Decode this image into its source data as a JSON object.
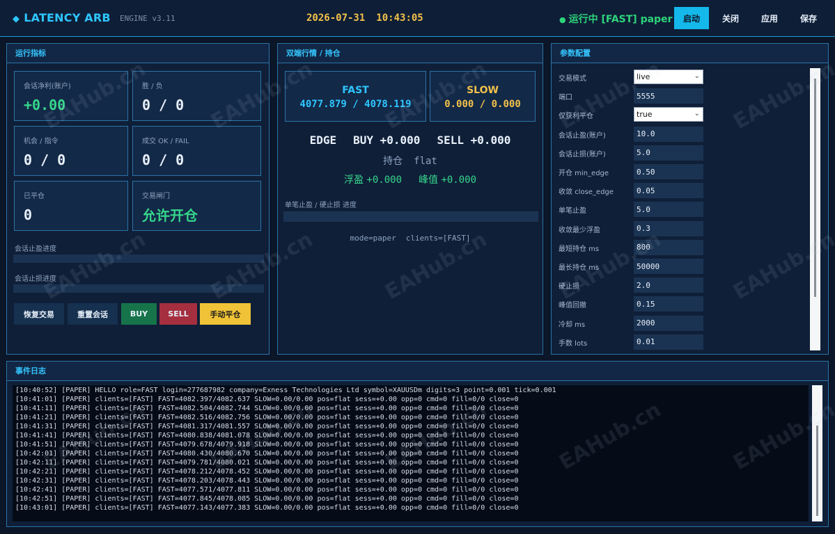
{
  "header": {
    "brand": "LATENCY ARB",
    "engine": "ENGINE v3.11",
    "date": "2026-07-31",
    "time": "10:43:05",
    "status": "运行中 [FAST] paper",
    "buttons": {
      "start": "启动",
      "close": "关闭",
      "apply": "应用",
      "save": "保存"
    }
  },
  "metrics": {
    "title": "运行指标",
    "cards": {
      "net_profit": {
        "label": "会话净利(账户)",
        "value": "+0.00"
      },
      "win_loss": {
        "label": "胜 / 负",
        "value": "0 / 0"
      },
      "opp_cmd": {
        "label": "机会 / 指令",
        "value": "0 / 0"
      },
      "fills": {
        "label": "成交 OK / FAIL",
        "value": "0 / 0"
      },
      "closed": {
        "label": "已平仓",
        "value": "0"
      },
      "gate": {
        "label": "交易闸门",
        "value": "允许开仓"
      }
    },
    "tp_progress": {
      "label": "会话止盈进度",
      "fraction": 0
    },
    "sl_progress": {
      "label": "会话止损进度",
      "fraction": 0
    },
    "actions": {
      "resume": "恢复交易",
      "reset": "重置会话",
      "buy": "BUY",
      "sell": "SELL",
      "manual_close": "手动平仓"
    }
  },
  "market": {
    "title": "双端行情 / 持仓",
    "fast": {
      "name": "FAST",
      "quote": "4077.879 / 4078.119"
    },
    "slow": {
      "name": "SLOW",
      "quote": "0.000 / 0.000"
    },
    "edge": {
      "label": "EDGE",
      "buy": "BUY +0.000",
      "sell": "SELL +0.000"
    },
    "position": {
      "label": "持仓",
      "value": "flat"
    },
    "floating": {
      "label": "浮盈",
      "value": "+0.000"
    },
    "peak": {
      "label": "峰值",
      "value": "+0.000"
    },
    "trade_progress": {
      "label": "单笔止盈 / 硬止损 进度",
      "fraction": 0
    },
    "mode": "mode=paper",
    "clients": "clients=[FAST]"
  },
  "params": {
    "title": "参数配置",
    "rows": [
      {
        "label": "交易模式",
        "value": "live",
        "type": "select"
      },
      {
        "label": "端口",
        "value": "5555",
        "type": "input"
      },
      {
        "label": "仅获利平仓",
        "value": "true",
        "type": "select"
      },
      {
        "label": "会话止盈(账户)",
        "value": "10.0",
        "type": "input"
      },
      {
        "label": "会话止损(账户)",
        "value": "5.0",
        "type": "input"
      },
      {
        "label": "开仓 min_edge",
        "value": "0.50",
        "type": "input"
      },
      {
        "label": "收敛 close_edge",
        "value": "0.05",
        "type": "input"
      },
      {
        "label": "单笔止盈",
        "value": "5.0",
        "type": "input"
      },
      {
        "label": "收敛最少浮盈",
        "value": "0.3",
        "type": "input"
      },
      {
        "label": "最短持仓 ms",
        "value": "800",
        "type": "input"
      },
      {
        "label": "最长持仓 ms",
        "value": "50000",
        "type": "input"
      },
      {
        "label": "硬止损",
        "value": "2.0",
        "type": "input"
      },
      {
        "label": "峰值回撤",
        "value": "0.15",
        "type": "input"
      },
      {
        "label": "冷却 ms",
        "value": "2000",
        "type": "input"
      },
      {
        "label": "手数 lots",
        "value": "0.01",
        "type": "input"
      }
    ]
  },
  "log": {
    "title": "事件日志",
    "lines": [
      "[10:40:52] [PAPER] HELLO role=FAST login=277687982 company=Exness Technologies Ltd symbol=XAUUSDm digits=3 point=0.001 tick=0.001",
      "[10:41:01] [PAPER] clients=[FAST] FAST=4082.397/4082.637 SLOW=0.00/0.00 pos=flat sess=+0.00 opp=0 cmd=0 fill=0/0 close=0",
      "[10:41:11] [PAPER] clients=[FAST] FAST=4082.504/4082.744 SLOW=0.00/0.00 pos=flat sess=+0.00 opp=0 cmd=0 fill=0/0 close=0",
      "[10:41:21] [PAPER] clients=[FAST] FAST=4082.516/4082.756 SLOW=0.00/0.00 pos=flat sess=+0.00 opp=0 cmd=0 fill=0/0 close=0",
      "[10:41:31] [PAPER] clients=[FAST] FAST=4081.317/4081.557 SLOW=0.00/0.00 pos=flat sess=+0.00 opp=0 cmd=0 fill=0/0 close=0",
      "[10:41:41] [PAPER] clients=[FAST] FAST=4080.838/4081.078 SLOW=0.00/0.00 pos=flat sess=+0.00 opp=0 cmd=0 fill=0/0 close=0",
      "[10:41:51] [PAPER] clients=[FAST] FAST=4079.678/4079.918 SLOW=0.00/0.00 pos=flat sess=+0.00 opp=0 cmd=0 fill=0/0 close=0",
      "[10:42:01] [PAPER] clients=[FAST] FAST=4080.430/4080.670 SLOW=0.00/0.00 pos=flat sess=+0.00 opp=0 cmd=0 fill=0/0 close=0",
      "[10:42:11] [PAPER] clients=[FAST] FAST=4079.781/4080.021 SLOW=0.00/0.00 pos=flat sess=+0.00 opp=0 cmd=0 fill=0/0 close=0",
      "[10:42:21] [PAPER] clients=[FAST] FAST=4078.212/4078.452 SLOW=0.00/0.00 pos=flat sess=+0.00 opp=0 cmd=0 fill=0/0 close=0",
      "[10:42:31] [PAPER] clients=[FAST] FAST=4078.203/4078.443 SLOW=0.00/0.00 pos=flat sess=+0.00 opp=0 cmd=0 fill=0/0 close=0",
      "[10:42:41] [PAPER] clients=[FAST] FAST=4077.571/4077.811 SLOW=0.00/0.00 pos=flat sess=+0.00 opp=0 cmd=0 fill=0/0 close=0",
      "[10:42:51] [PAPER] clients=[FAST] FAST=4077.845/4078.085 SLOW=0.00/0.00 pos=flat sess=+0.00 opp=0 cmd=0 fill=0/0 close=0",
      "[10:43:01] [PAPER] clients=[FAST] FAST=4077.143/4077.383 SLOW=0.00/0.00 pos=flat sess=+0.00 opp=0 cmd=0 fill=0/0 close=0"
    ]
  },
  "watermark": "EAHub.cn",
  "colors": {
    "accent": "#2ec6ff",
    "gold": "#f2c14b",
    "green": "#36d68c",
    "buy": "#17744a",
    "sell": "#a52f3e",
    "manual": "#f0c237",
    "background": "#0b1628"
  }
}
